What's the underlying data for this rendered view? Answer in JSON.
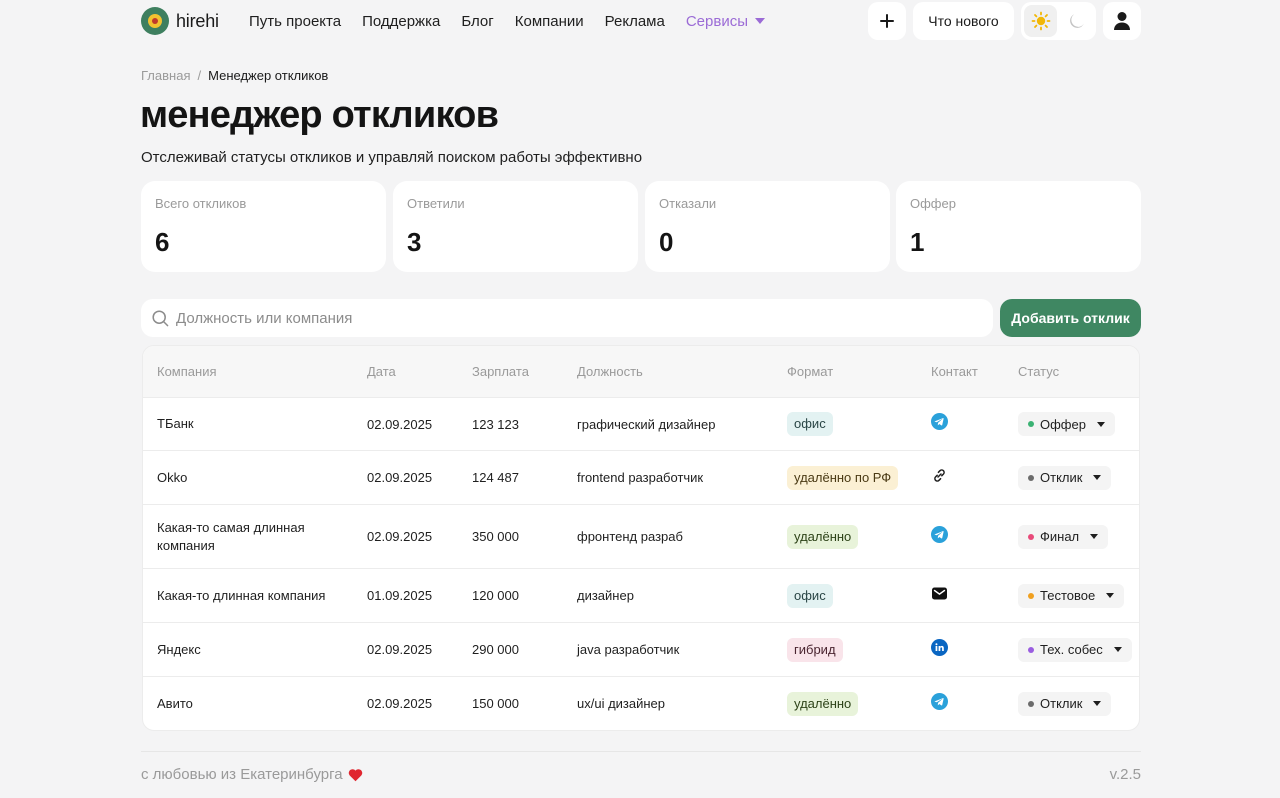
{
  "header": {
    "logo_text": "hirehi",
    "nav": [
      "Путь проекта",
      "Поддержка",
      "Блог",
      "Компании",
      "Реклама"
    ],
    "services_label": "Сервисы",
    "add_icon": "plus-icon",
    "whats_new_label": "Что нового",
    "theme": {
      "light_icon": "sun-icon",
      "dark_icon": "moon-icon",
      "active": "light"
    },
    "profile_icon": "user-icon"
  },
  "breadcrumb": {
    "home": "Главная",
    "separator": "/",
    "current": "Менеджер откликов"
  },
  "page": {
    "title": "менеджер откликов",
    "subtitle": "Отслеживай статусы откликов и управляй поиском работы эффективно"
  },
  "stats": [
    {
      "label": "Всего откликов",
      "value": "6"
    },
    {
      "label": "Ответили",
      "value": "3"
    },
    {
      "label": "Отказали",
      "value": "0"
    },
    {
      "label": "Оффер",
      "value": "1"
    }
  ],
  "search": {
    "placeholder": "Должность или компания",
    "value": ""
  },
  "add_button_label": "Добавить отклик",
  "table": {
    "headers": {
      "company": "Компания",
      "date": "Дата",
      "salary": "Зарплата",
      "position": "Должность",
      "format": "Формат",
      "contact": "Контакт",
      "status": "Статус"
    },
    "rows": [
      {
        "company": "ТБанк",
        "date": "02.09.2025",
        "salary": "123 123",
        "position": "графический дизайнер",
        "format": "офис",
        "format_kind": "office",
        "contact_icon": "telegram-icon",
        "status": "Оффер",
        "status_color": "#3bb273"
      },
      {
        "company": "Okko",
        "date": "02.09.2025",
        "salary": "124 487",
        "position": "frontend разработчик",
        "format": "удалённо по РФ",
        "format_kind": "remote-rf",
        "contact_icon": "link-icon",
        "status": "Отклик",
        "status_color": "#6b6b6b"
      },
      {
        "company": "Какая-то самая длинная компания",
        "date": "02.09.2025",
        "salary": "350 000",
        "position": "фронтенд разраб",
        "format": "удалённо",
        "format_kind": "remote",
        "contact_icon": "telegram-icon",
        "status": "Финал",
        "status_color": "#e84a7a"
      },
      {
        "company": "Какая-то длинная компания",
        "date": "01.09.2025",
        "salary": "120 000",
        "position": "дизайнер",
        "format": "офис",
        "format_kind": "office",
        "contact_icon": "mail-icon",
        "status": "Тестовое",
        "status_color": "#f0a020"
      },
      {
        "company": "Яндекс",
        "date": "02.09.2025",
        "salary": "290 000",
        "position": "java разработчик",
        "format": "гибрид",
        "format_kind": "hybrid",
        "contact_icon": "linkedin-icon",
        "status": "Тех. собес",
        "status_color": "#9a5de0"
      },
      {
        "company": "Авито",
        "date": "02.09.2025",
        "salary": "150 000",
        "position": "ux/ui дизайнер",
        "format": "удалённо",
        "format_kind": "remote",
        "contact_icon": "telegram-icon",
        "status": "Отклик",
        "status_color": "#6b6b6b"
      }
    ]
  },
  "footer": {
    "left": "с любовью из Екатеринбурга",
    "heart_icon": "heart-icon",
    "version": "v.2.5"
  },
  "colors": {
    "accent_green": "#3f8762",
    "services_purple": "#9b6bd6",
    "background": "#f4f4f5"
  }
}
